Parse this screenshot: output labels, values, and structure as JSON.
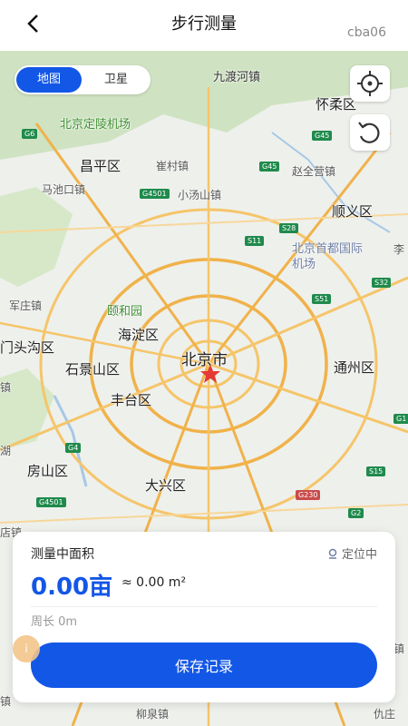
{
  "header": {
    "title": "步行测量",
    "corner_text": "cba06"
  },
  "map": {
    "mode_toggle": {
      "active": "地图",
      "inactive": "卫星"
    },
    "labels": {
      "jiuduhe": "九渡河镇",
      "huairou": "怀柔区",
      "dingling": "北京定陵机场",
      "changping": "昌平区",
      "cuicun": "崔村镇",
      "zhaoquanying": "赵全营镇",
      "machikou": "马池口镇",
      "xiaotangshan": "小汤山镇",
      "shunyi": "顺义区",
      "capital_airport": "北京首都国际机场",
      "li": "李",
      "junzhuang": "军庄镇",
      "yiheyuan": "颐和园",
      "haidian": "海淀区",
      "mentougou": "门头沟区",
      "beijing": "北京市",
      "shijingshan": "石景山区",
      "tongzhou": "通州区",
      "zhen": "镇",
      "fengtai": "丰台区",
      "hu": "湖",
      "fangshan": "房山区",
      "daxing": "大兴区",
      "dian": "店镇",
      "zhen2": "镇",
      "liuquan": "柳泉镇",
      "qiu": "仇庄",
      "ban": "镇"
    },
    "shields": [
      "G6",
      "G45",
      "G45",
      "G4501",
      "S28",
      "S11",
      "S32",
      "S51",
      "G1",
      "G4",
      "S15",
      "G4501",
      "G230",
      "G2",
      "G4"
    ]
  },
  "card": {
    "title": "测量中面积",
    "locating": "定位中",
    "area_value": "0.00亩",
    "area_sqm": "≈ 0.00 m²",
    "perimeter": "周长 0m",
    "save_label": "保存记录",
    "fab_label": "i"
  },
  "colors": {
    "primary": "#1357e6",
    "map_bg": "#eef0ec",
    "road": "#f5c56a",
    "greenland": "#cfe3c2"
  }
}
